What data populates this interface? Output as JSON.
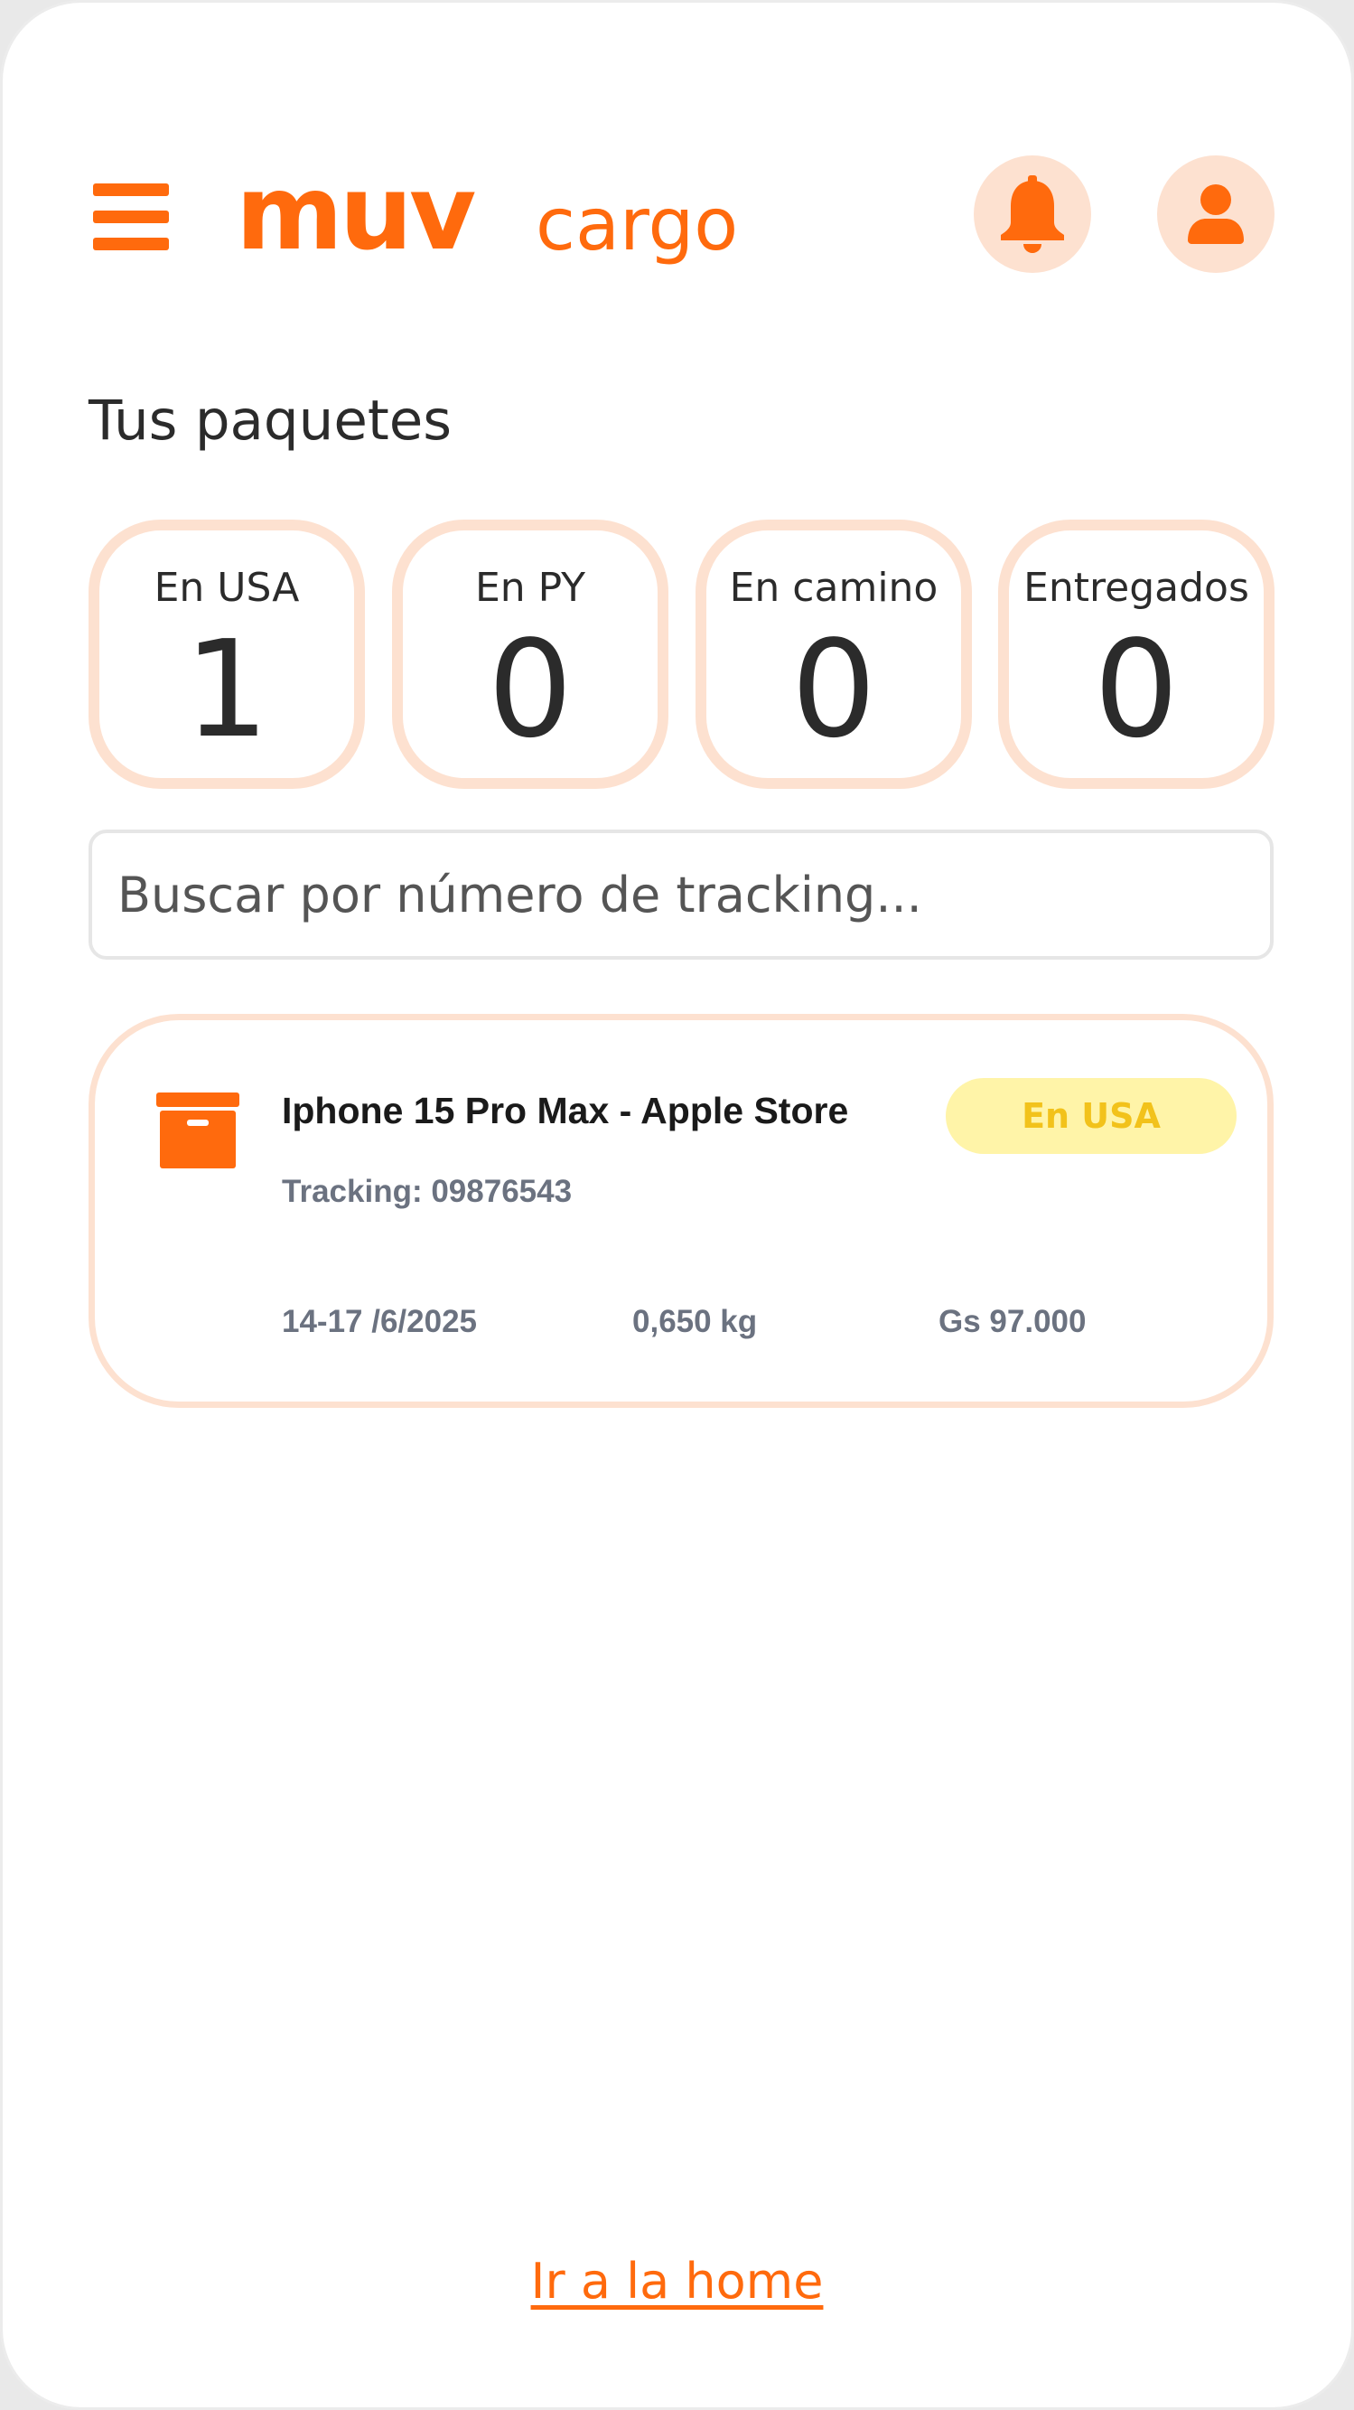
{
  "header": {
    "logo_primary": "muv",
    "logo_secondary": "cargo",
    "brand_color": "#ff6a0d",
    "menu_icon": "hamburger-menu-icon",
    "notification_icon": "bell-icon",
    "profile_icon": "user-icon"
  },
  "section_title": "Tus paquetes",
  "stats": [
    {
      "label": "En USA",
      "count": "1"
    },
    {
      "label": "En PY",
      "count": "0"
    },
    {
      "label": "En camino",
      "count": "0"
    },
    {
      "label": "Entregados",
      "count": "0"
    }
  ],
  "search": {
    "placeholder": "Buscar por número de tracking...",
    "value": ""
  },
  "packages": [
    {
      "icon": "archive-box-icon",
      "title": "Iphone 15 Pro Max - Apple Store",
      "tracking": "Tracking: 09876543",
      "status": "En USA",
      "status_bg": "#fff4a8",
      "status_color": "#f2c21b",
      "date": "14-17 /6/2025",
      "weight": "0,650 kg",
      "price": "Gs 97.000"
    }
  ],
  "footer": {
    "home_link": "Ir a la home"
  }
}
